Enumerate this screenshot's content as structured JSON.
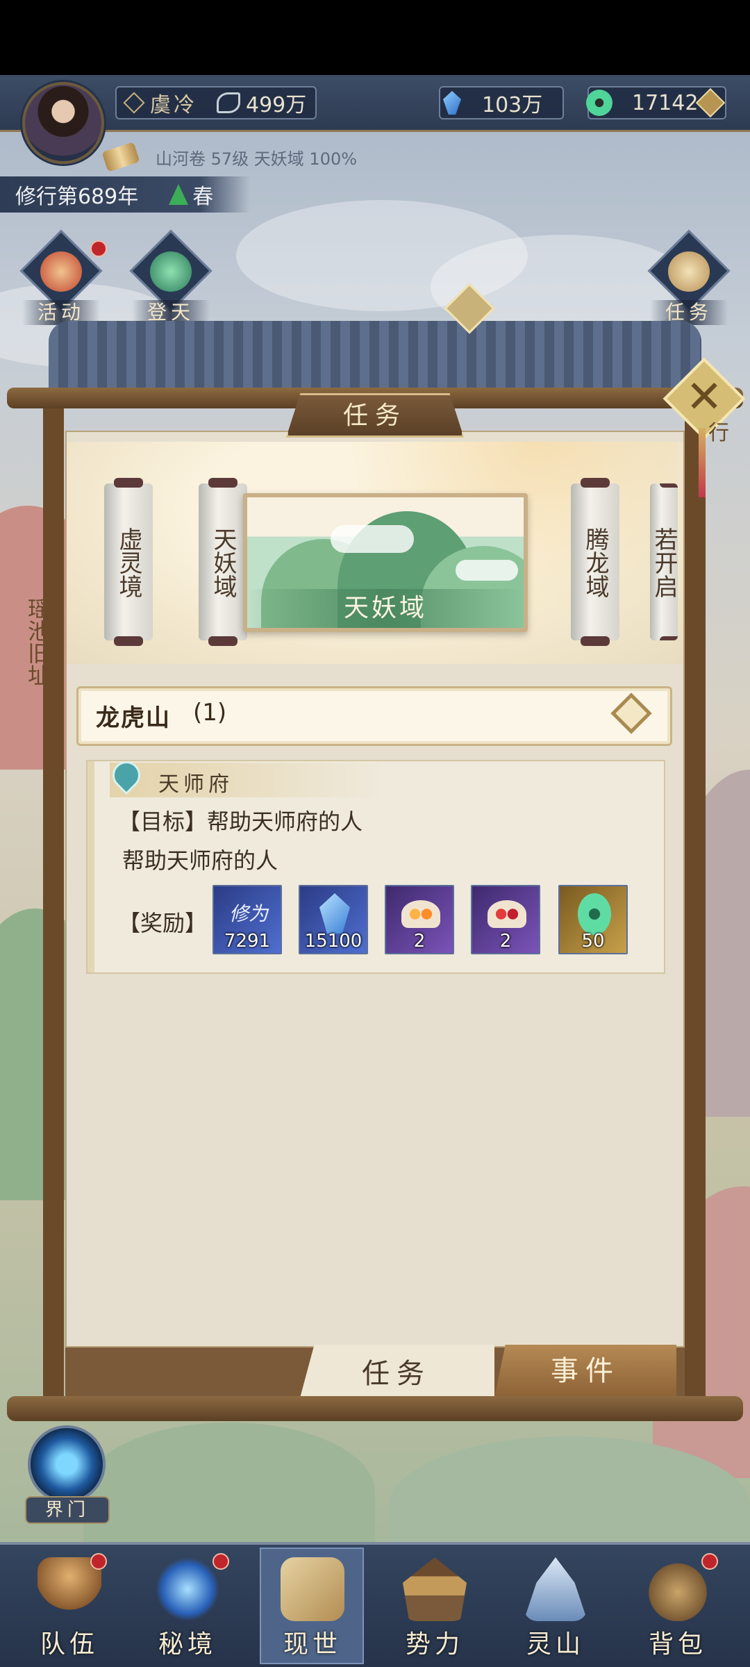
{
  "header": {
    "player_name": "虞冷",
    "power": "499万",
    "crystal": "103万",
    "jade": "17142",
    "scroll_info": "山河卷 57级 天妖域 100%",
    "year": "修行第689年",
    "season": "春"
  },
  "side_buttons": {
    "activity": "活动",
    "ascend": "登天",
    "tasks": "任务",
    "realm_gate": "界门",
    "side_text_right": "行"
  },
  "dialog": {
    "title": "任务",
    "close_icon": "close-icon",
    "realms": [
      "虚灵境",
      "天妖域",
      "腾龙域",
      "若开启"
    ],
    "selected_realm": "天妖域",
    "left_edge_text": "瑶池旧址",
    "dropdown": {
      "label": "龙虎山",
      "count": "(1)"
    },
    "task": {
      "location": "天师府",
      "goal": "【目标】帮助天师府的人",
      "description": "帮助天师府的人",
      "reward_label": "【奖励】",
      "rewards": [
        {
          "name": "修为",
          "qty": "7291",
          "icon": "xiuwei-icon"
        },
        {
          "name": "灵石",
          "qty": "15100",
          "icon": "crystal-icon"
        },
        {
          "name": "丹药",
          "qty": "2",
          "icon": "pill-bowl-icon"
        },
        {
          "name": "丹药",
          "qty": "2",
          "icon": "pill-bowl-icon"
        },
        {
          "name": "玉",
          "qty": "50",
          "icon": "jade-icon"
        }
      ]
    },
    "tabs": {
      "task": "任务",
      "event": "事件"
    }
  },
  "bottom_nav": [
    {
      "label": "队伍",
      "icon": "team-icon",
      "badge": true
    },
    {
      "label": "秘境",
      "icon": "secret-realm-icon",
      "badge": true
    },
    {
      "label": "现世",
      "icon": "world-icon",
      "badge": false,
      "active": true
    },
    {
      "label": "势力",
      "icon": "faction-icon",
      "badge": false
    },
    {
      "label": "灵山",
      "icon": "spirit-mountain-icon",
      "badge": false
    },
    {
      "label": "背包",
      "icon": "bag-icon",
      "badge": true
    }
  ],
  "colors": {
    "accent_wood": "#7b5a3a",
    "nav_bg": "#2d3b52",
    "badge_red": "#c0252c"
  }
}
